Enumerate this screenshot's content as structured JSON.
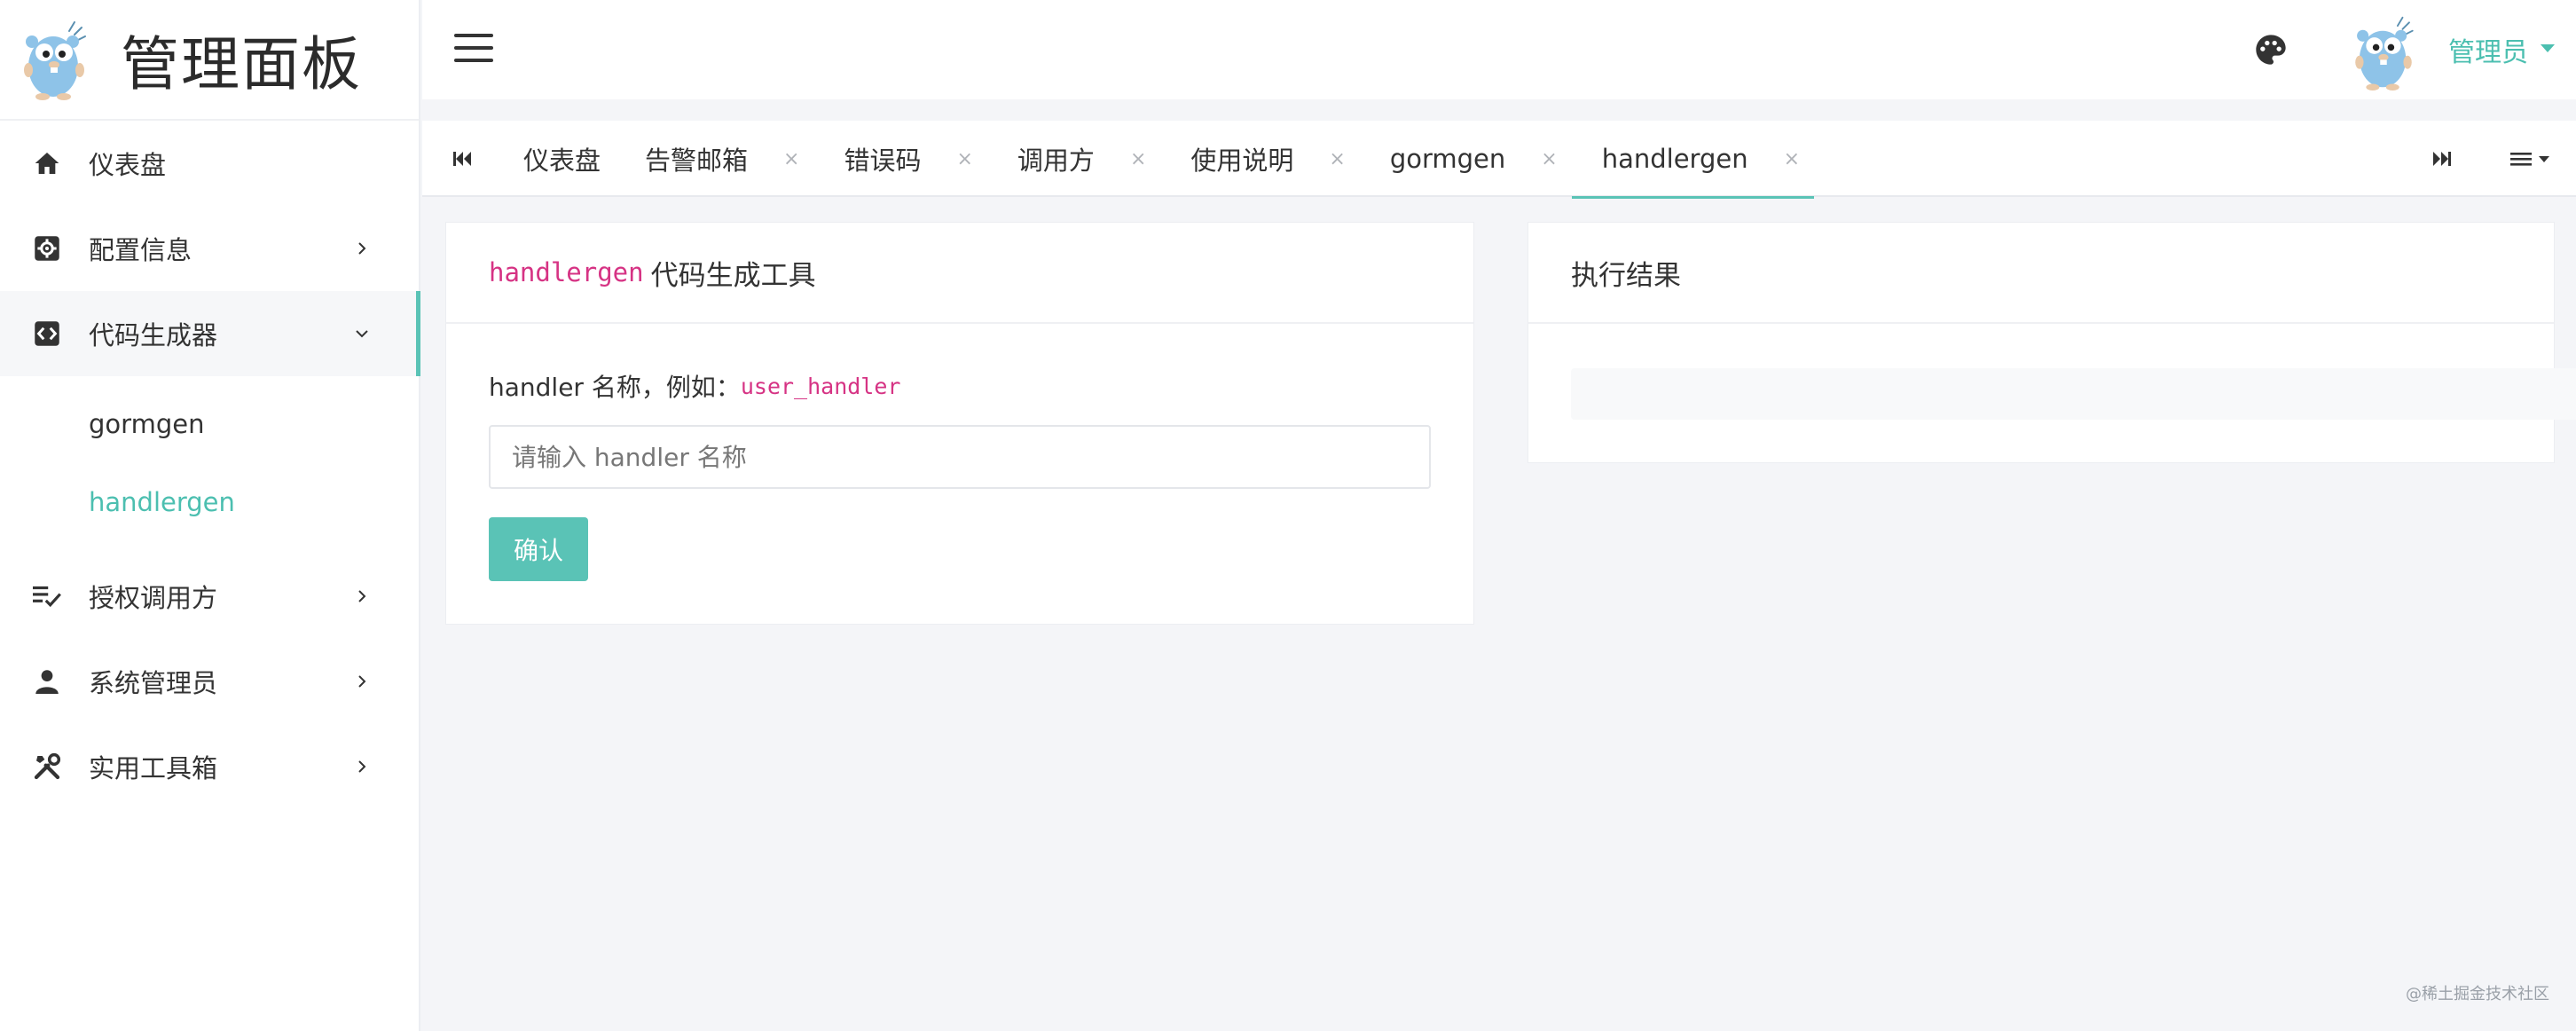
{
  "brand": {
    "title": "管理面板"
  },
  "sidebar": {
    "items": [
      {
        "label": "仪表盘"
      },
      {
        "label": "配置信息"
      },
      {
        "label": "代码生成器"
      },
      {
        "label": "授权调用方"
      },
      {
        "label": "系统管理员"
      },
      {
        "label": "实用工具箱"
      }
    ],
    "submenu": [
      {
        "label": "gormgen"
      },
      {
        "label": "handlergen"
      }
    ]
  },
  "header": {
    "user": "管理员"
  },
  "tabs": [
    {
      "label": "仪表盘"
    },
    {
      "label": "告警邮箱"
    },
    {
      "label": "错误码"
    },
    {
      "label": "调用方"
    },
    {
      "label": "使用说明"
    },
    {
      "label": "gormgen"
    },
    {
      "label": "handlergen"
    }
  ],
  "tab_close": "×",
  "form": {
    "title_code": "handlergen",
    "title_text": "代码生成工具",
    "label_text": "handler 名称，例如：",
    "label_code": "user_handler",
    "placeholder": "请输入 handler 名称",
    "confirm": "确认"
  },
  "result": {
    "title": "执行结果"
  },
  "watermark": "@稀土掘金技术社区",
  "colors": {
    "accent": "#5ac3b6",
    "code": "#d63384"
  }
}
